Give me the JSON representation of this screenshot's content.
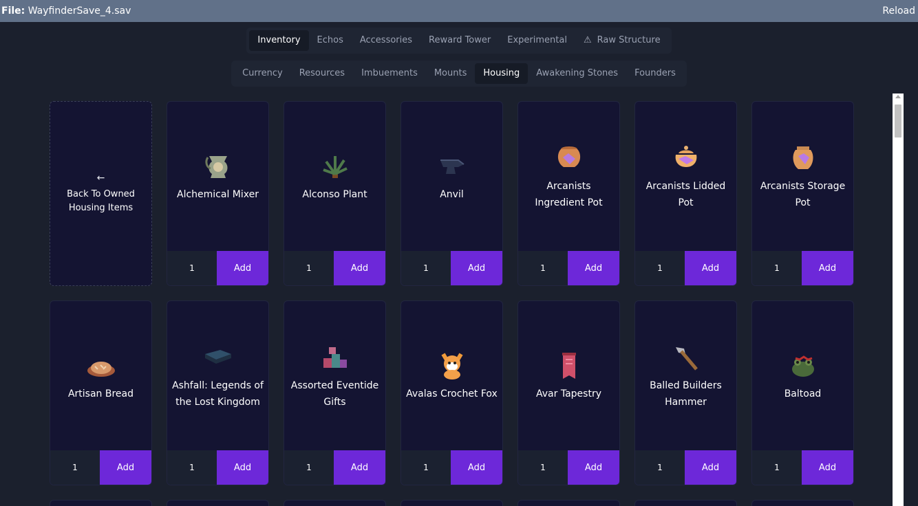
{
  "titlebar": {
    "file_label": "File:",
    "file_name": "WayfinderSave_4.sav",
    "reload": "Reload"
  },
  "main_tabs": [
    {
      "label": "Inventory",
      "active": true
    },
    {
      "label": "Echos",
      "active": false
    },
    {
      "label": "Accessories",
      "active": false
    },
    {
      "label": "Reward Tower",
      "active": false
    },
    {
      "label": "Experimental",
      "active": false
    },
    {
      "label": "Raw Structure",
      "active": false,
      "icon": "warning-icon"
    }
  ],
  "sub_tabs": [
    {
      "label": "Currency",
      "active": false
    },
    {
      "label": "Resources",
      "active": false
    },
    {
      "label": "Imbuements",
      "active": false
    },
    {
      "label": "Mounts",
      "active": false
    },
    {
      "label": "Housing",
      "active": true
    },
    {
      "label": "Awakening Stones",
      "active": false
    },
    {
      "label": "Founders",
      "active": false
    }
  ],
  "back_card": {
    "arrow": "←",
    "label": "Back To Owned Housing Items"
  },
  "add_label": "Add",
  "items": [
    {
      "name": "Alchemical Mixer",
      "qty": "1",
      "icon": "mixer-icon"
    },
    {
      "name": "Alconso Plant",
      "qty": "1",
      "icon": "plant-icon"
    },
    {
      "name": "Anvil",
      "qty": "1",
      "icon": "anvil-icon"
    },
    {
      "name": "Arcanists Ingredient Pot",
      "qty": "1",
      "icon": "pot-icon"
    },
    {
      "name": "Arcanists Lidded Pot",
      "qty": "1",
      "icon": "lidded-pot-icon"
    },
    {
      "name": "Arcanists Storage Pot",
      "qty": "1",
      "icon": "storage-pot-icon"
    },
    {
      "name": "Artisan Bread",
      "qty": "1",
      "icon": "bread-icon"
    },
    {
      "name": "Ashfall: Legends of the Lost Kingdom",
      "qty": "1",
      "icon": "book-icon"
    },
    {
      "name": "Assorted Eventide Gifts",
      "qty": "1",
      "icon": "gifts-icon"
    },
    {
      "name": "Avalas Crochet Fox",
      "qty": "1",
      "icon": "fox-icon"
    },
    {
      "name": "Avar Tapestry",
      "qty": "1",
      "icon": "tapestry-icon"
    },
    {
      "name": "Balled Builders Hammer",
      "qty": "1",
      "icon": "hammer-icon"
    },
    {
      "name": "Baltoad",
      "qty": "1",
      "icon": "toad-icon"
    }
  ]
}
